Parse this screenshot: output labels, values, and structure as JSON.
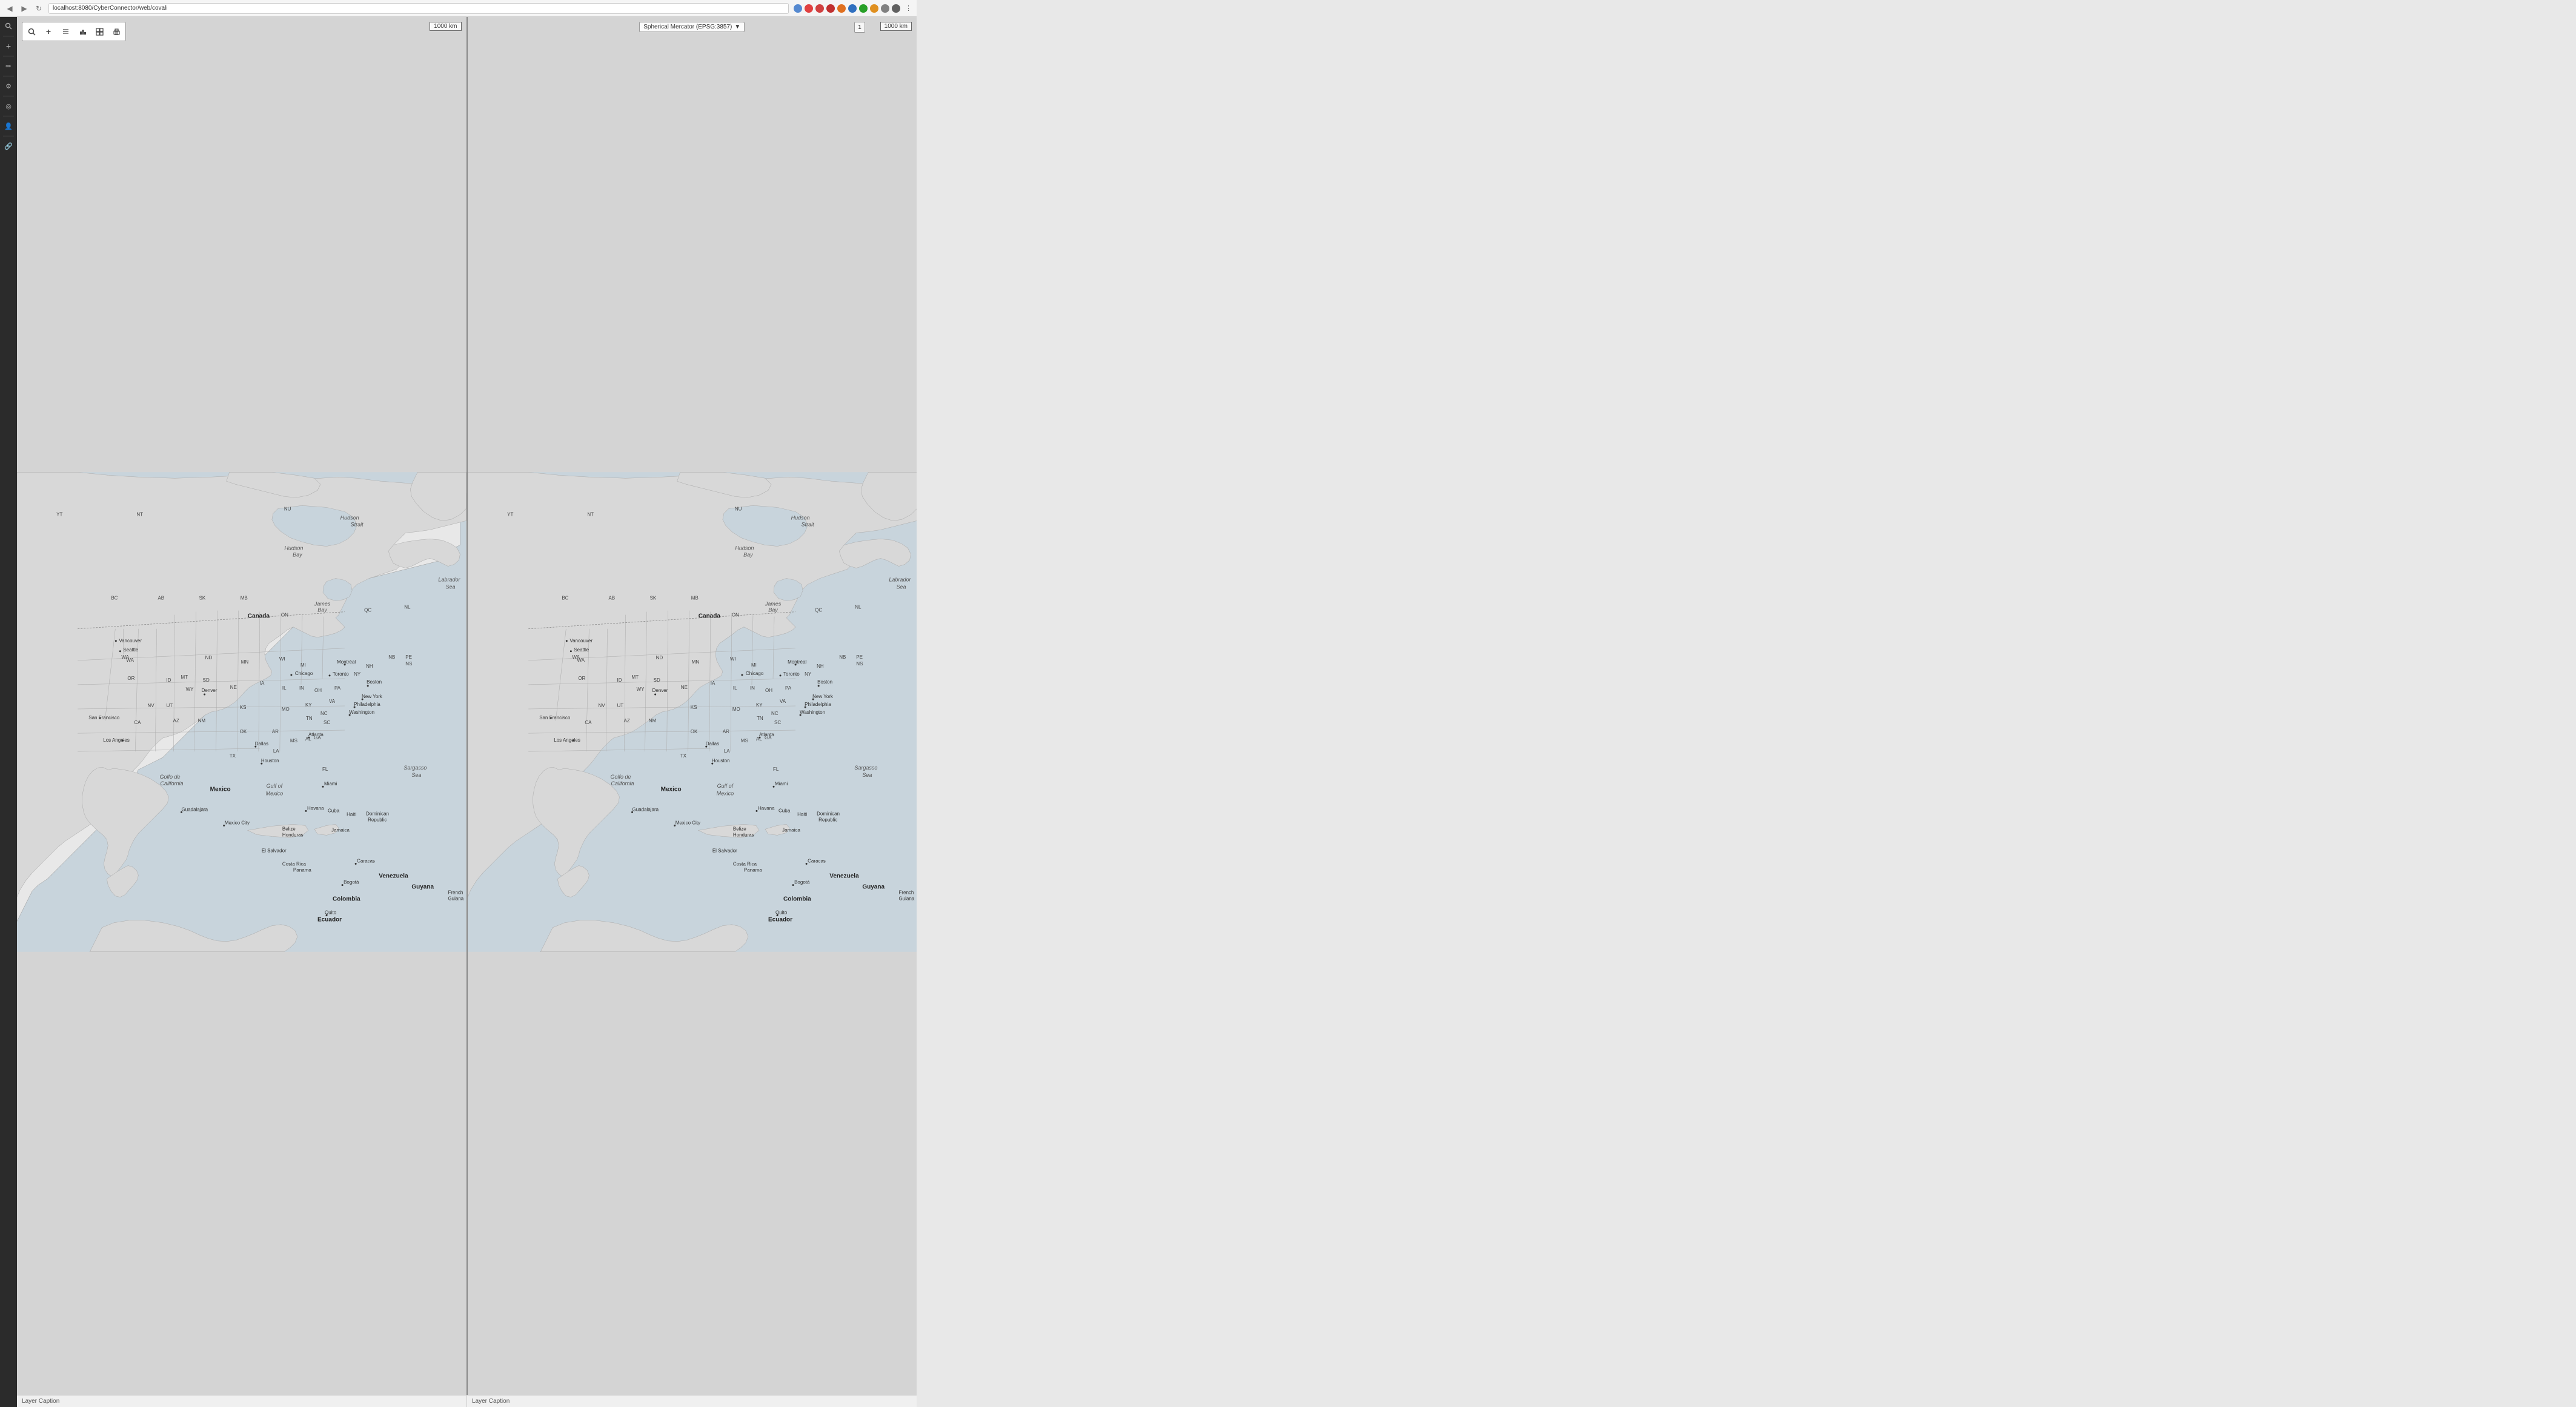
{
  "browser": {
    "url": "localhost:8080/CyberConnector/web/covali",
    "nav_back": "◀",
    "nav_forward": "▶",
    "nav_refresh": "↻"
  },
  "toolbar": {
    "buttons": [
      {
        "name": "search-button",
        "icon": "🔍"
      },
      {
        "name": "add-button",
        "icon": "+"
      },
      {
        "name": "list-button",
        "icon": "≡"
      },
      {
        "name": "chart-button",
        "icon": "◫"
      },
      {
        "name": "grid-button",
        "icon": "⊞"
      },
      {
        "name": "print-button",
        "icon": "🖶"
      }
    ]
  },
  "sidebar": {
    "buttons": [
      {
        "name": "search-side",
        "icon": "🔍"
      },
      {
        "name": "add-side",
        "icon": "+"
      },
      {
        "name": "draw-side",
        "icon": "✏"
      },
      {
        "name": "settings-side",
        "icon": "⚙"
      },
      {
        "name": "layers-side",
        "icon": "⊕"
      },
      {
        "name": "person-side",
        "icon": "👤"
      },
      {
        "name": "link-side",
        "icon": "🔗"
      }
    ]
  },
  "map_left": {
    "scale_label": "1000 km",
    "caption": "Layer Caption"
  },
  "map_right": {
    "projection_label": "Spherical Mercator (EPSG:3857)",
    "scale_label": "1000 km",
    "caption": "Layer Caption",
    "toggle_label": "1"
  },
  "map_labels": {
    "hudson_strait": "Hudson\nStrait",
    "hudson_bay": "Hudson\nBay",
    "james_bay": "James\nBay",
    "labrador_sea": "Labrador\nSea",
    "canada": "Canada",
    "mexico": "Mexico",
    "gulf_mexico": "Gulf of\nMexico",
    "golfo_california": "Golfo de\nCalifornia",
    "sargasso_sea": "Sargasso\nSea",
    "venezuela": "Venezuela",
    "colombia": "Colombia",
    "guyana": "Guyana",
    "french_guiana": "French\nGuiana",
    "cuba": "Cuba",
    "haiti": "Haiti",
    "dominican_republic": "Dominican\nRepublic",
    "jamaica": "Jamaica",
    "belize": "Belize",
    "honduras": "Honduras",
    "el_salvador": "El Salvador",
    "costa_rica": "Costa Rica",
    "panama": "Panama",
    "havana": "Havana",
    "toronto": "Toronto",
    "montreal": "Montréal",
    "boston": "Boston",
    "new_york": "New York",
    "philadelphia": "Philadelphia",
    "washington": "Washington",
    "chicago": "Chicago",
    "denver": "Denver",
    "dallas": "Dallas",
    "houston": "Houston",
    "los_angeles": "Los Angeles",
    "san_francisco": "San Francisco",
    "miami": "Miami",
    "atlanta": "Atlanta",
    "vancouver": "Vancouver",
    "seattle": "Seattle",
    "guadalajara": "Guadalajara",
    "mexico_city": "Mexico City",
    "bogota": "Bogotá",
    "caracas": "Caracas",
    "quito": "Quito",
    "ecuador": "Ecuador"
  }
}
